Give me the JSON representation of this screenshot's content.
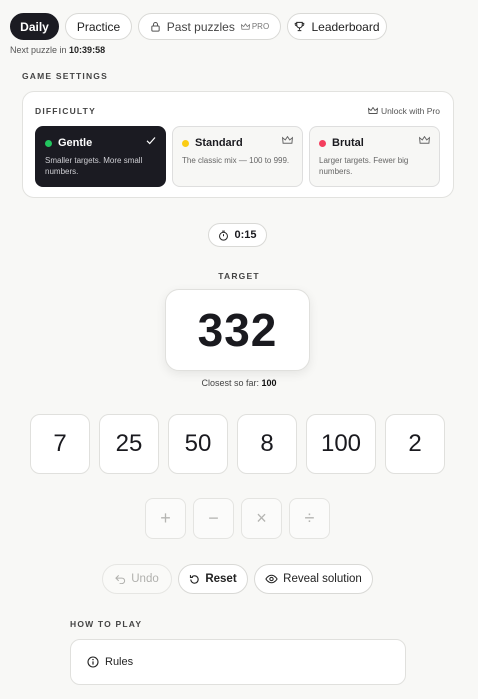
{
  "tabs": [
    {
      "label": "Daily",
      "active": true
    },
    {
      "label": "Practice",
      "active": false
    },
    {
      "label": "Past puzzles",
      "active": false,
      "badge": "PRO",
      "icon": "lock-icon"
    },
    {
      "label": "Leaderboard",
      "active": false,
      "icon": "trophy-icon"
    }
  ],
  "next_puzzle": {
    "label": "Next puzzle in",
    "time": "10:39:58"
  },
  "settings": {
    "section_label": "GAME SETTINGS",
    "difficulty_label": "DIFFICULTY",
    "unlock_label": "Unlock with Pro",
    "options": [
      {
        "name": "Gentle",
        "desc": "Smaller targets. More small numbers.",
        "color": "#22c55e",
        "selected": true,
        "mark": "check-icon"
      },
      {
        "name": "Standard",
        "desc": "The classic mix — 100 to 999.",
        "color": "#facc15",
        "selected": false,
        "mark": "crown-icon"
      },
      {
        "name": "Brutal",
        "desc": "Larger targets. Fewer big numbers.",
        "color": "#f43f5e",
        "selected": false,
        "mark": "crown-icon"
      }
    ]
  },
  "timer": "0:15",
  "target": {
    "label": "TARGET",
    "value": "332",
    "closest_label": "Closest so far:",
    "closest_value": "100"
  },
  "numbers": [
    "7",
    "25",
    "50",
    "8",
    "100",
    "2"
  ],
  "operators": [
    "+",
    "−",
    "×",
    "÷"
  ],
  "actions": {
    "undo": "Undo",
    "reset": "Reset",
    "reveal": "Reveal solution"
  },
  "how_to_play": {
    "label": "HOW TO PLAY",
    "rules": "Rules"
  }
}
